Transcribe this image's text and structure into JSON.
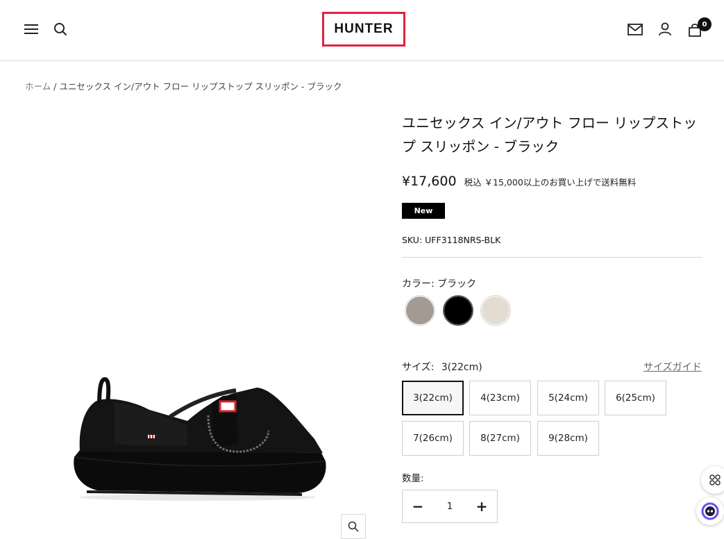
{
  "header": {
    "logo_text": "HUNTER",
    "menu_icon": "hamburger-menu-icon",
    "search_icon": "search-icon",
    "mail_icon": "mail-icon",
    "account_icon": "user-icon",
    "cart_icon": "shopping-bag-icon",
    "cart_count": "0",
    "brand_color": "#e1213f"
  },
  "breadcrumb": {
    "home": "ホーム",
    "separator": "/",
    "current": "ユニセックス イン/アウト フロー リップストップ スリッポン - ブラック"
  },
  "product": {
    "title": "ユニセックス イン/アウト フロー リップストップ スリッポン - ブラック",
    "price": "¥17,600",
    "price_note": "税込 ￥15,000以上のお買い上げで送料無料",
    "badge": "New",
    "sku": "SKU: UFF3118NRS-BLK",
    "color_label": "カラー:",
    "color_value": "ブラック",
    "colors": [
      {
        "name": "taupe",
        "hex": "#a39a93",
        "selected": false
      },
      {
        "name": "black",
        "hex": "#000000",
        "selected": true
      },
      {
        "name": "cream",
        "hex": "#e3dcd2",
        "selected": false
      }
    ],
    "size_label": "サイズ:",
    "size_value": "3(22cm)",
    "size_guide": "サイズガイド",
    "sizes": [
      "3(22cm)",
      "4(23cm)",
      "5(24cm)",
      "6(25cm)",
      "7(26cm)",
      "8(27cm)",
      "9(28cm)"
    ],
    "selected_size_index": 0,
    "quantity_label": "数量:",
    "quantity": "1",
    "minus_symbol": "−",
    "plus_symbol": "+"
  },
  "image": {
    "alt": "black slip-on shoe",
    "zoom_icon": "zoom-in-icon"
  },
  "floating": {
    "apps_icon": "apps-icon",
    "chat_icon": "chat-bot-icon"
  }
}
